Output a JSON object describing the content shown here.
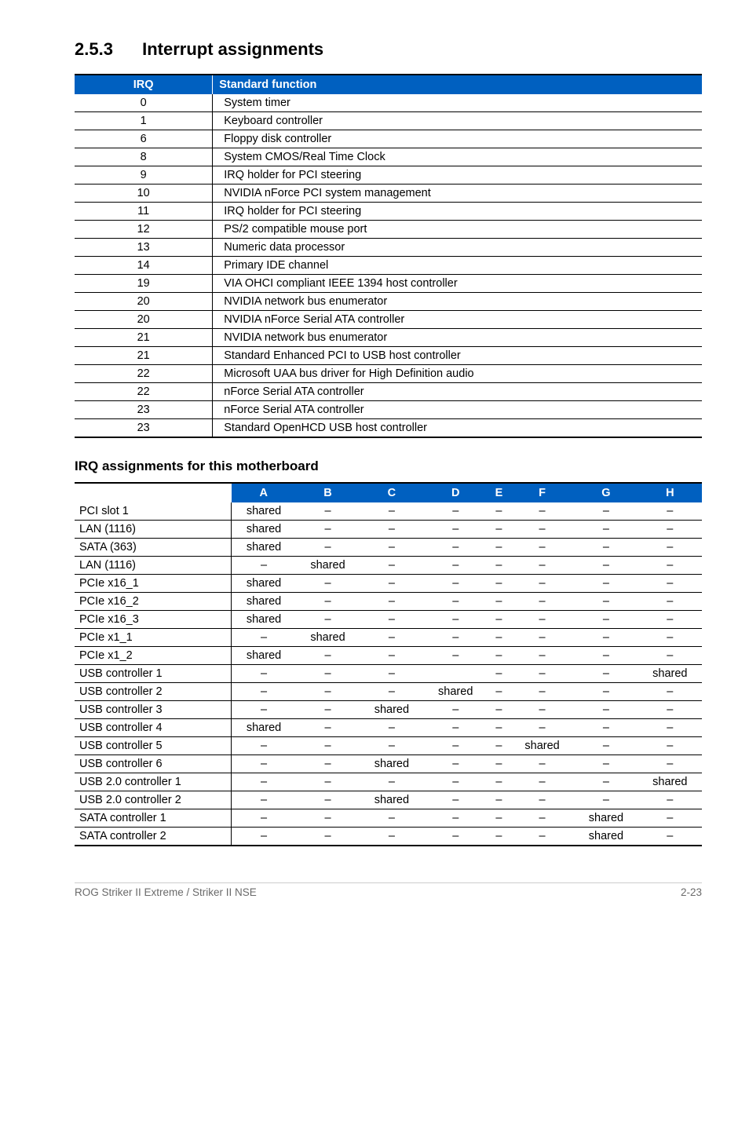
{
  "section": {
    "number": "2.5.3",
    "title": "Interrupt assignments"
  },
  "irq_table": {
    "headers": {
      "irq": "IRQ",
      "fn": "Standard function"
    },
    "rows": [
      {
        "irq": "0",
        "fn": "System timer"
      },
      {
        "irq": "1",
        "fn": "Keyboard controller"
      },
      {
        "irq": "6",
        "fn": "Floppy disk controller"
      },
      {
        "irq": "8",
        "fn": "System CMOS/Real Time Clock"
      },
      {
        "irq": "9",
        "fn": "IRQ holder for PCI steering"
      },
      {
        "irq": "10",
        "fn": "NVIDIA nForce PCI system management"
      },
      {
        "irq": "11",
        "fn": "IRQ holder for PCI steering"
      },
      {
        "irq": "12",
        "fn": "PS/2 compatible mouse port"
      },
      {
        "irq": "13",
        "fn": "Numeric data processor"
      },
      {
        "irq": "14",
        "fn": "Primary IDE channel"
      },
      {
        "irq": "19",
        "fn": "VIA OHCI compliant IEEE 1394 host controller"
      },
      {
        "irq": "20",
        "fn": "NVIDIA network bus enumerator"
      },
      {
        "irq": "20",
        "fn": "NVIDIA nForce Serial ATA controller"
      },
      {
        "irq": "21",
        "fn": "NVIDIA network bus enumerator"
      },
      {
        "irq": "21",
        "fn": "Standard Enhanced PCI to USB host controller"
      },
      {
        "irq": "22",
        "fn": "Microsoft UAA bus driver for High Definition audio"
      },
      {
        "irq": "22",
        "fn": "nForce Serial ATA controller"
      },
      {
        "irq": "23",
        "fn": "nForce Serial ATA controller"
      },
      {
        "irq": "23",
        "fn": "Standard OpenHCD USB host controller"
      }
    ]
  },
  "assign_title": "IRQ assignments for this motherboard",
  "assign_table": {
    "headers": [
      "",
      "A",
      "B",
      "C",
      "D",
      "E",
      "F",
      "G",
      "H"
    ],
    "rows": [
      {
        "dev": "PCI slot 1",
        "cells": [
          "shared",
          "–",
          "–",
          "–",
          "–",
          "–",
          "–",
          "–"
        ]
      },
      {
        "dev": "LAN (1116)",
        "cells": [
          "shared",
          "–",
          "–",
          "–",
          "–",
          "–",
          "–",
          "–"
        ]
      },
      {
        "dev": "SATA (363)",
        "cells": [
          "shared",
          "–",
          "–",
          "–",
          "–",
          "–",
          "–",
          "–"
        ]
      },
      {
        "dev": "LAN (1116)",
        "cells": [
          "–",
          "shared",
          "–",
          "–",
          "–",
          "–",
          "–",
          "–"
        ]
      },
      {
        "dev": "PCIe x16_1",
        "cells": [
          "shared",
          "–",
          "–",
          "–",
          "–",
          "–",
          "–",
          "–"
        ]
      },
      {
        "dev": "PCIe x16_2",
        "cells": [
          "shared",
          "–",
          "–",
          "–",
          "–",
          "–",
          "–",
          "–"
        ]
      },
      {
        "dev": "PCIe x16_3",
        "cells": [
          "shared",
          "–",
          "–",
          "–",
          "–",
          "–",
          "–",
          "–"
        ]
      },
      {
        "dev": "PCIe x1_1",
        "cells": [
          "–",
          "shared",
          "–",
          "–",
          "–",
          "–",
          "–",
          "–"
        ]
      },
      {
        "dev": "PCIe x1_2",
        "cells": [
          "shared",
          "–",
          "–",
          "–",
          "–",
          "–",
          "–",
          "–"
        ]
      },
      {
        "dev": "USB controller 1",
        "cells": [
          "–",
          "–",
          "–",
          "",
          "–",
          "–",
          "–",
          "shared"
        ]
      },
      {
        "dev": "USB controller 2",
        "cells": [
          "–",
          "–",
          "–",
          "shared",
          "–",
          "–",
          "–",
          "–"
        ]
      },
      {
        "dev": "USB controller 3",
        "cells": [
          "–",
          "–",
          "shared",
          "–",
          "–",
          "–",
          "–",
          "–"
        ]
      },
      {
        "dev": "USB controller 4",
        "cells": [
          "shared",
          "–",
          "–",
          "–",
          "–",
          "–",
          "–",
          "–"
        ]
      },
      {
        "dev": "USB controller 5",
        "cells": [
          "–",
          "–",
          "–",
          "–",
          "–",
          "shared",
          "–",
          "–"
        ]
      },
      {
        "dev": "USB controller 6",
        "cells": [
          "–",
          "–",
          "shared",
          "–",
          "–",
          "–",
          "–",
          "–"
        ]
      },
      {
        "dev": "USB 2.0 controller 1",
        "cells": [
          "–",
          "–",
          "–",
          "–",
          "–",
          "–",
          "–",
          "shared"
        ]
      },
      {
        "dev": "USB 2.0 controller 2",
        "cells": [
          "–",
          "–",
          "shared",
          "–",
          "–",
          "–",
          "–",
          "–"
        ]
      },
      {
        "dev": "SATA controller 1",
        "cells": [
          "–",
          "–",
          "–",
          "–",
          "–",
          "–",
          "shared",
          "–"
        ]
      },
      {
        "dev": "SATA controller 2",
        "cells": [
          "–",
          "–",
          "–",
          "–",
          "–",
          "–",
          "shared",
          "–"
        ]
      }
    ]
  },
  "footer": {
    "left": "ROG Striker II Extreme / Striker II NSE",
    "right": "2-23"
  }
}
